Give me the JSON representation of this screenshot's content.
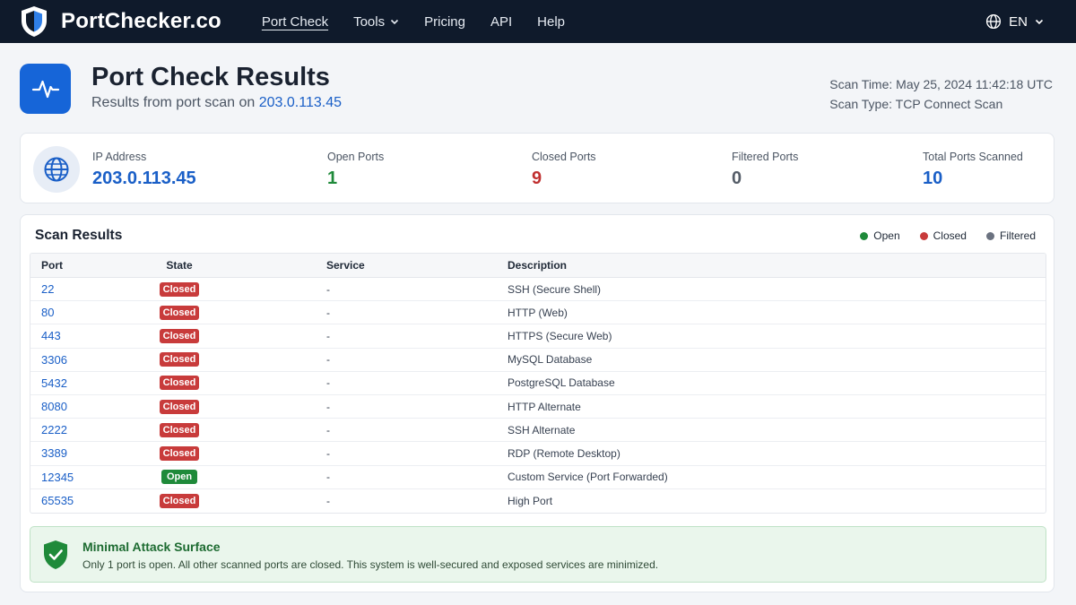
{
  "nav": {
    "brand": "PortChecker.co",
    "links": [
      {
        "label": "Port Check",
        "active": true
      },
      {
        "label": "Tools",
        "dropdown": true
      },
      {
        "label": "Pricing"
      },
      {
        "label": "API"
      },
      {
        "label": "Help"
      }
    ],
    "language": "EN"
  },
  "header": {
    "title": "Port Check Results",
    "subtitle_prefix": "Results from port scan on",
    "ip": "203.0.113.45",
    "scan_time": "Scan Time: May 25, 2024 11:42:18 UTC",
    "scan_type": "Scan Type: TCP Connect Scan"
  },
  "stats": [
    {
      "label": "IP Address",
      "value": "203.0.113.45",
      "color": "#1a5fc7"
    },
    {
      "label": "Open Ports",
      "value": "1",
      "color": "#1f8a3a"
    },
    {
      "label": "Closed Ports",
      "value": "9",
      "color": "#c03030"
    },
    {
      "label": "Filtered Ports",
      "value": "0",
      "color": "#555d68"
    },
    {
      "label": "Total Ports Scanned",
      "value": "10",
      "color": "#1a5fc7"
    }
  ],
  "results": {
    "title": "Scan Results",
    "legend": [
      {
        "label": "Open",
        "color": "#1f8a3a"
      },
      {
        "label": "Closed",
        "color": "#c83b3b"
      },
      {
        "label": "Filtered",
        "color": "#6b7280"
      }
    ],
    "columns": [
      "Port",
      "State",
      "Service",
      "Description"
    ],
    "rows": [
      {
        "port": "22",
        "state": "Closed",
        "service": "-",
        "description": "SSH (Secure Shell)"
      },
      {
        "port": "80",
        "state": "Closed",
        "service": "-",
        "description": "HTTP (Web)"
      },
      {
        "port": "443",
        "state": "Closed",
        "service": "-",
        "description": "HTTPS (Secure Web)"
      },
      {
        "port": "3306",
        "state": "Closed",
        "service": "-",
        "description": "MySQL Database"
      },
      {
        "port": "5432",
        "state": "Closed",
        "service": "-",
        "description": "PostgreSQL Database"
      },
      {
        "port": "8080",
        "state": "Closed",
        "service": "-",
        "description": "HTTP Alternate"
      },
      {
        "port": "2222",
        "state": "Closed",
        "service": "-",
        "description": "SSH Alternate"
      },
      {
        "port": "3389",
        "state": "Closed",
        "service": "-",
        "description": "RDP (Remote Desktop)"
      },
      {
        "port": "12345",
        "state": "Open",
        "service": "-",
        "description": "Custom Service (Port Forwarded)"
      },
      {
        "port": "65535",
        "state": "Closed",
        "service": "-",
        "description": "High Port"
      }
    ]
  },
  "notice": {
    "title": "Minimal Attack Surface",
    "text": "Only 1 port is open. All other scanned ports are closed. This system is well-secured and exposed services are minimized."
  }
}
